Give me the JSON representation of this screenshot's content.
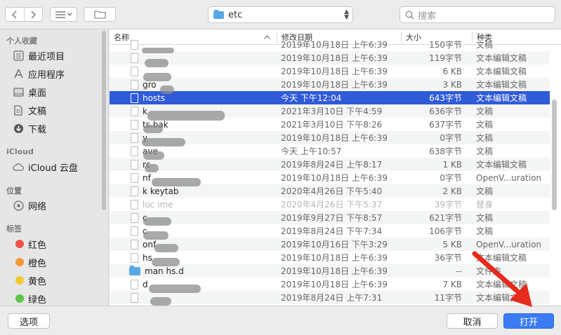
{
  "toolbar": {
    "back_icon": "chevron-left",
    "forward_icon": "chevron-right",
    "view_icon": "list-view",
    "new_folder_icon": "new-folder",
    "location": "etc",
    "search_placeholder": "搜索"
  },
  "sidebar": {
    "sections": [
      {
        "label": "个人收藏"
      },
      {
        "label": "iCloud"
      },
      {
        "label": "位置"
      },
      {
        "label": "标签"
      }
    ],
    "favorites": [
      {
        "label": "最近项目",
        "icon": "clock-icon"
      },
      {
        "label": "应用程序",
        "icon": "applications-icon"
      },
      {
        "label": "桌面",
        "icon": "desktop-icon"
      },
      {
        "label": "文稿",
        "icon": "documents-icon"
      },
      {
        "label": "下载",
        "icon": "download-icon"
      }
    ],
    "icloud": [
      {
        "label": "iCloud 云盘",
        "icon": "cloud-icon"
      }
    ],
    "locations": [
      {
        "label": "网络",
        "icon": "network-icon"
      }
    ],
    "tags": [
      {
        "label": "红色",
        "color": "#f0524a"
      },
      {
        "label": "橙色",
        "color": "#f39a36"
      },
      {
        "label": "黄色",
        "color": "#f3c930"
      },
      {
        "label": "绿色",
        "color": "#5cc548"
      }
    ]
  },
  "columns": {
    "name": "名称",
    "date": "修改日期",
    "size": "大小",
    "kind": "种类"
  },
  "files": [
    {
      "name": "",
      "date": "2019年10月18日 上午6:39",
      "size": "150字节",
      "kind": "文稿"
    },
    {
      "name": "",
      "date": "2019年10月18日 上午6:39",
      "size": "119字节",
      "kind": "文本编辑文稿"
    },
    {
      "name": "",
      "date": "2019年10月18日 上午6:39",
      "size": "6 KB",
      "kind": "文本编辑文稿"
    },
    {
      "name": "gro",
      "date": "2019年10月18日 上午6:39",
      "size": "3 KB",
      "kind": "文本编辑文稿"
    },
    {
      "name": "hosts",
      "date": "今天 下午12:04",
      "size": "643字节",
      "kind": "文本编辑文稿"
    },
    {
      "name": "k",
      "date": "2021年3月10日 下午4:59",
      "size": "636字节",
      "kind": "文稿"
    },
    {
      "name": "ts.bak",
      "date": "2021年3月10日 下午8:26",
      "size": "637字节",
      "kind": "文稿"
    },
    {
      "name": "y",
      "date": "2019年10月18日 上午6:39",
      "size": "0字节",
      "kind": "文稿"
    },
    {
      "name": "ave",
      "date": "今天 上午10:57",
      "size": "638字节",
      "kind": "文稿"
    },
    {
      "name": "rc",
      "date": "2019年8月24日 上午8:17",
      "size": "1 KB",
      "kind": "文本编辑文稿"
    },
    {
      "name": "nf",
      "date": "2019年10月18日 上午6:39",
      "size": "0字节",
      "kind": "OpenV...uration"
    },
    {
      "name": "k keytab",
      "date": "2020年4月26日 下午5:40",
      "size": "2 KB",
      "kind": "文稿"
    },
    {
      "name": "loc  ime",
      "date": "2020年4月26日 下午5:37",
      "size": "39字节",
      "kind": "替身"
    },
    {
      "name": "c",
      "date": "2019年9月27日 下午8:57",
      "size": "621字节",
      "kind": "文稿"
    },
    {
      "name": "c",
      "date": "2019年8月24日 下午7:34",
      "size": "106字节",
      "kind": "文稿"
    },
    {
      "name": "onf",
      "date": "2019年10月16日 下午3:29",
      "size": "5 KB",
      "kind": "OpenV...uration"
    },
    {
      "name": "hs",
      "date": "2019年10月18日 上午6:39",
      "size": "36字节",
      "kind": "文本编辑文稿"
    },
    {
      "name": "man  hs.d",
      "date": "2019年10月18日 上午6:39",
      "size": "--",
      "kind": "文件夹"
    },
    {
      "name": "d",
      "date": "2019年10月18日 上午6:39",
      "size": "7 KB",
      "kind": "文本编辑文稿"
    },
    {
      "name": "",
      "date": "2019年8月24日 上午7:31",
      "size": "11字节",
      "kind": "文本编辑文稿"
    }
  ],
  "buttons": {
    "options": "选项",
    "cancel": "取消",
    "open": "打开"
  },
  "colors": {
    "selection": "#2f5ad8",
    "primary_button": "#3b7cf4",
    "annotation_arrow": "#e82a1c"
  }
}
